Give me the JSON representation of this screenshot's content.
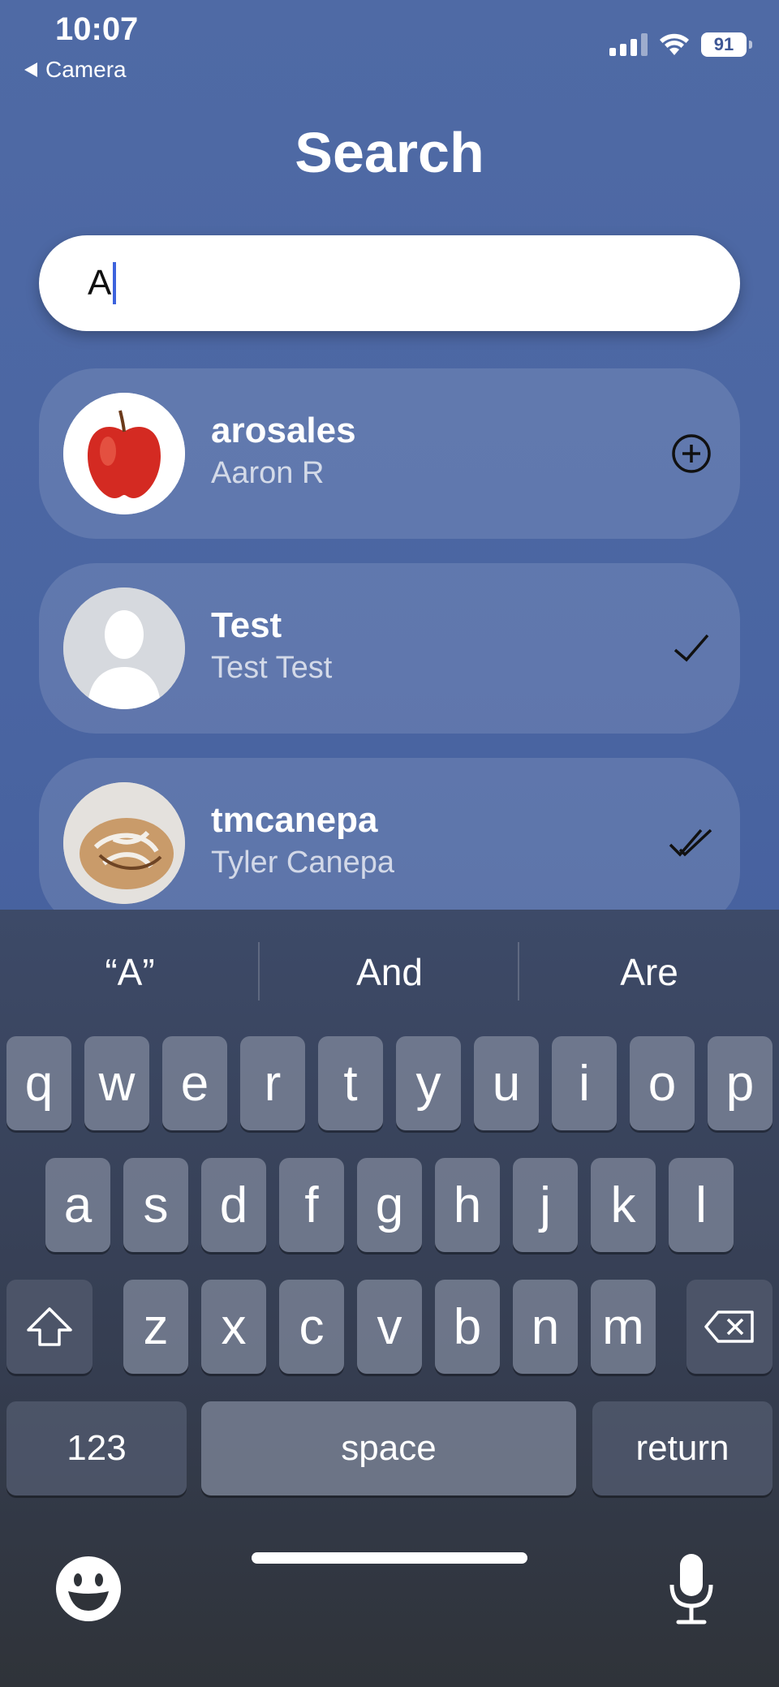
{
  "status_bar": {
    "time": "10:07",
    "back_label": "Camera",
    "battery": "91"
  },
  "header": {
    "title": "Search"
  },
  "search": {
    "value": "A"
  },
  "results": [
    {
      "username": "arosales",
      "full_name": "Aaron R",
      "action_icon": "add-circle-icon",
      "avatar": "apple"
    },
    {
      "username": "Test",
      "full_name": "Test Test",
      "action_icon": "checkmark-icon",
      "avatar": "placeholder-silhouette"
    },
    {
      "username": "tmcanepa",
      "full_name": "Tyler Canepa",
      "action_icon": "double-checkmark-icon",
      "avatar": "cinnamon-roll"
    }
  ],
  "keyboard": {
    "suggestions": [
      "“A”",
      "And",
      "Are"
    ],
    "row1": [
      "q",
      "w",
      "e",
      "r",
      "t",
      "y",
      "u",
      "i",
      "o",
      "p"
    ],
    "row2": [
      "a",
      "s",
      "d",
      "f",
      "g",
      "h",
      "j",
      "k",
      "l"
    ],
    "row3": [
      "z",
      "x",
      "c",
      "v",
      "b",
      "n",
      "m"
    ],
    "numbers_label": "123",
    "space_label": "space",
    "return_label": "return"
  }
}
